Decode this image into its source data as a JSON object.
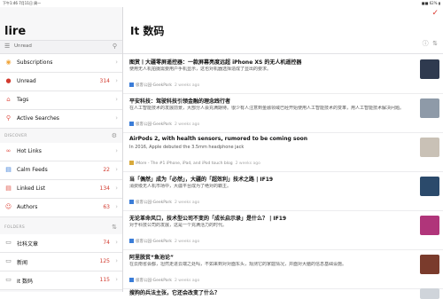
{
  "statusbar": {
    "left": "下午1:46  7月11日 周一",
    "right": "■■ 62% ▮"
  },
  "sidebar": {
    "title": "lire",
    "filter": {
      "label": "Unread"
    },
    "items": [
      {
        "label": "Subscriptions",
        "count": "",
        "color": "#f0a53a"
      },
      {
        "label": "Unread",
        "count": "314",
        "color": "#d23b2f"
      },
      {
        "label": "Tags",
        "count": "",
        "color": "#e0554a"
      },
      {
        "label": "Active Searches",
        "count": "",
        "color": "#e0554a"
      }
    ],
    "discover": {
      "heading": "DISCOVER",
      "items": [
        {
          "label": "Hot Links",
          "count": "",
          "color": "#e0554a"
        },
        {
          "label": "Calm Feeds",
          "count": "22",
          "color": "#3b7dd8"
        },
        {
          "label": "Linked List",
          "count": "134",
          "color": "#e0554a"
        },
        {
          "label": "Authors",
          "count": "63",
          "color": "#e0554a"
        }
      ]
    },
    "folders": {
      "heading": "FOLDERS",
      "items": [
        {
          "label": "社科文章",
          "count": "74"
        },
        {
          "label": "新闻",
          "count": "125"
        },
        {
          "label": "It 数码",
          "count": "115"
        }
      ]
    }
  },
  "main": {
    "title": "It 数码",
    "articles": [
      {
        "title": "图赏丨大疆零屏遥控器：一款屏幕亮度远超 iPhone XS 的无人机遥控器",
        "summary": "使用无人机拍摄需要用户手机显示，这也对机器选择造成了显出的要求。",
        "source": "极客公园-GeekPark",
        "time": "2 weeks ago",
        "thumb_color": "#2f3a4f"
      },
      {
        "title": "平安科技：驾驶科技引领金融的理念践行者",
        "summary": "在人工智能技术的发展前景，大部分人会充满期待。很少有人注意到金融领域已经开始使用人工智能技术的变革，用人工智能技术解决问题。",
        "source": "极客公园-GeekPark",
        "time": "2 weeks ago",
        "thumb_color": "#8e9aa8"
      },
      {
        "title": "AirPods 2, with health sensors, rumored to be coming soon",
        "summary": "In 2016, Apple debuted the 3.5mm headphone jack",
        "source": "iMore - The #1 iPhone, iPad, and iPod touch blog",
        "time": "2 weeks ago",
        "thumb_color": "#c9c1b6"
      },
      {
        "title": "当「偶然」成为「必然」，大疆的「超效利」技术之路 | IF19",
        "summary": "消费级无人机市场中，大疆平台成为了绝对的霸主。",
        "source": "极客公园-GeekPark",
        "time": "2 weeks ago",
        "thumb_color": "#2b4a6b"
      },
      {
        "title": "无论革命风口，技术型公司不变的「成长启示录」是什么？ | IF19",
        "summary": "对于科技公司的发展，这是一个充满活力的时代。",
        "source": "极客公园-GeekPark",
        "time": "2 weeks ago",
        "thumb_color": "#b0357a"
      },
      {
        "title": "阿里脱贫“鱼池论”",
        "summary": "在云南省会都，坦然走进云端之处吗，不如来到对对面东头，观测它的家庭情况，并面对大脑的信息基础设施。",
        "source": "极客公园-GeekPark",
        "time": "2 weeks ago",
        "thumb_color": "#7a3b2c"
      },
      {
        "title": "搜狗的兵法主张，它还会改变了什么？",
        "summary": "",
        "source": "",
        "time": "",
        "thumb_color": "#cfd4da"
      }
    ]
  }
}
